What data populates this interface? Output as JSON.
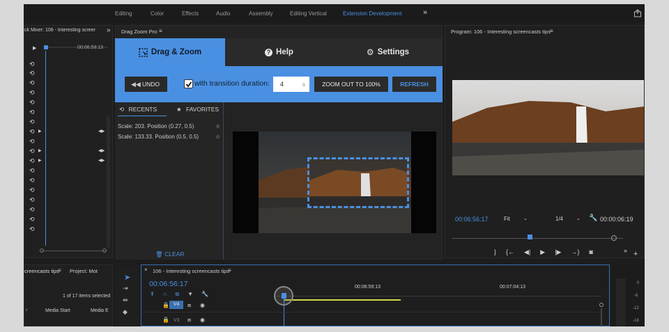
{
  "workspaces": [
    "Editing",
    "Color",
    "Effects",
    "Audio",
    "Assembly",
    "Editing Vertical",
    "Extension Development"
  ],
  "workspace_active": "Extension Development",
  "workspace_more": "»",
  "mixer": {
    "title": "ck Mixer: 106 - Interesting screer",
    "timecode": "00:06:59:13"
  },
  "dzp": {
    "title": "Drag Zoom Pro",
    "tabs": [
      "Drag & Zoom",
      "Help",
      "Settings"
    ],
    "undo": "UNDO",
    "transition_label": "with transition duration:",
    "duration_value": "4",
    "duration_unit": "s",
    "zoom_out": "ZOOM OUT TO 100%",
    "refresh": "REFRESH",
    "recents_tab": "RECENTS",
    "favorites_tab": "FAVORITES",
    "recents": [
      "Scale: 203. Position (0.27, 0.5)",
      "Scale: 133.33. Position (0.5, 0.5)"
    ],
    "clear": "CLEAR"
  },
  "program": {
    "title": "Program: 106 - Interesting screencasts tips",
    "timecode": "00:06:56:17",
    "fit": "Fit",
    "resolution": "1/4",
    "duration": "00:00:06:19"
  },
  "project": {
    "tab1": "creencasts tips",
    "tab2": "Project: Mot",
    "items": "1 of 17 items selected",
    "col1": "Media Start",
    "col2": "Media E"
  },
  "timeline": {
    "title": "106 - Interesting screencasts tips",
    "timecode": "00:06:56:17",
    "ruler1": "00:06:59:13",
    "ruler2": "00:07:04:13",
    "track_v4": "V4",
    "track_v3": "V3"
  },
  "meter_labels": [
    "0",
    "-6",
    "-12",
    "-18"
  ]
}
